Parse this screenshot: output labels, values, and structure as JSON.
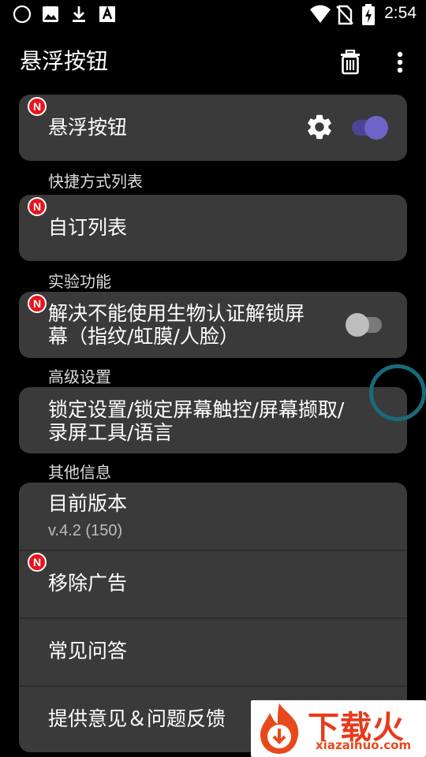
{
  "status_bar": {
    "time": "2:54",
    "left_icons": [
      "circle-icon",
      "image-icon",
      "download-icon",
      "font-a-icon"
    ],
    "right_icons": [
      "wifi-icon",
      "no-sim-icon",
      "battery-charging-icon"
    ]
  },
  "app_bar": {
    "title": "悬浮按钮",
    "actions": [
      "trash-icon",
      "more-vert-icon"
    ]
  },
  "badge_label": "N",
  "cards": {
    "floating_button": {
      "label": "悬浮按钮",
      "has_badge": true,
      "toggle_on": true
    },
    "custom_list": {
      "label": "自订列表",
      "has_badge": true
    },
    "biometric": {
      "label_line1": "解决不能使用生物认证解锁屏",
      "label_line2": "幕（指纹/虹膜/人脸）",
      "has_badge": true,
      "toggle_on": false
    },
    "advanced": {
      "label_line1": "锁定设置/锁定屏幕触控/屏幕撷取/",
      "label_line2": "录屏工具/语言"
    },
    "other": {
      "version_label": "目前版本",
      "version_value": "v.4.2 (150)",
      "remove_ads": "移除广告",
      "faq": "常见问答",
      "feedback": "提供意见＆问题反馈"
    }
  },
  "sections": {
    "shortcuts": "快捷方式列表",
    "experimental": "实验功能",
    "advanced": "高级设置",
    "other_info": "其他信息"
  },
  "colors": {
    "card_bg": "#3a3a3a",
    "badge_red": "#e8141c",
    "toggle_on_thumb": "#6e64c8",
    "toggle_on_track": "#4a4597",
    "toggle_off_thumb": "#bdbdbd",
    "toggle_off_track": "#7a7a7a",
    "float_ring": "#1a6a78"
  },
  "watermark": {
    "title": "下载火",
    "url": "xiazaihuo.com"
  }
}
